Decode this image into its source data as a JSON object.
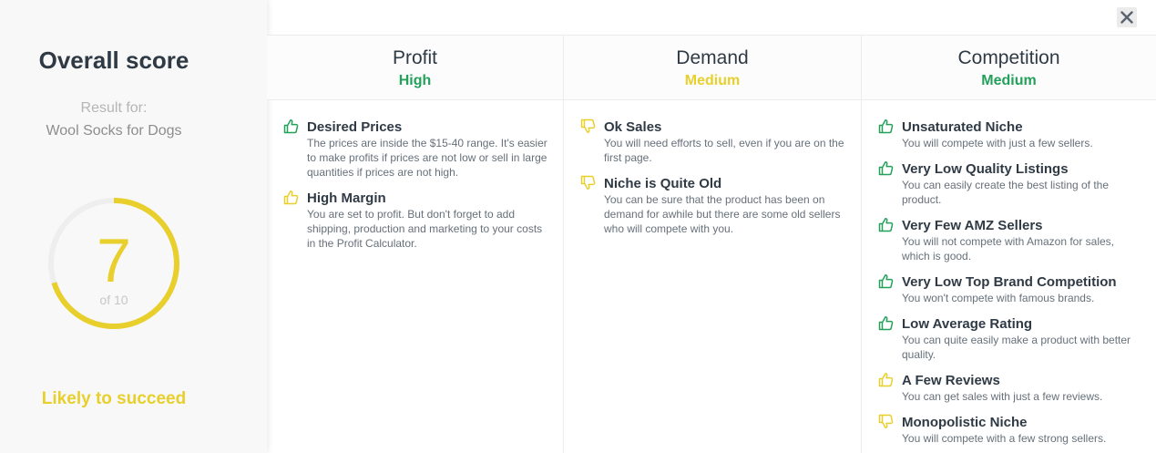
{
  "left": {
    "title": "Overall score",
    "result_label": "Result for:",
    "product": "Wool Socks for Dogs",
    "score": "7",
    "score_suffix": "of 10",
    "score_fraction": 0.7,
    "verdict": "Likely to succeed"
  },
  "close_icon": "close-icon",
  "colors": {
    "green": "#23a15a",
    "yellow": "#e9cf2c",
    "gauge_track": "#eeeeee"
  },
  "columns": [
    {
      "title": "Profit",
      "rating": "High",
      "rating_color": "green",
      "items": [
        {
          "icon": "thumbs-up-icon",
          "color": "green",
          "title": "Desired Prices",
          "desc": "The prices are inside the $15-40 range. It's easier to make profits if prices are not low or sell in large quantities if prices are not high."
        },
        {
          "icon": "thumbs-up-icon",
          "color": "yellow",
          "title": "High Margin",
          "desc": "You are set to profit. But don't forget to add shipping, production and marketing to your costs in the Profit Calculator."
        }
      ]
    },
    {
      "title": "Demand",
      "rating": "Medium",
      "rating_color": "yellow",
      "items": [
        {
          "icon": "thumbs-down-icon",
          "color": "yellow",
          "title": "Ok Sales",
          "desc": "You will need efforts to sell, even if you are on the first page."
        },
        {
          "icon": "thumbs-down-icon",
          "color": "yellow",
          "title": "Niche is Quite Old",
          "desc": "You can be sure that the product has been on demand for awhile but there are some old sellers who will compete with you."
        }
      ]
    },
    {
      "title": "Competition",
      "rating": "Medium",
      "rating_color": "green",
      "items": [
        {
          "icon": "thumbs-up-icon",
          "color": "green",
          "title": "Unsaturated Niche",
          "desc": "You will compete with just a few sellers."
        },
        {
          "icon": "thumbs-up-icon",
          "color": "green",
          "title": "Very Low Quality Listings",
          "desc": "You can easily create the best listing of the product."
        },
        {
          "icon": "thumbs-up-icon",
          "color": "green",
          "title": "Very Few AMZ Sellers",
          "desc": "You will not compete with Amazon for sales, which is good."
        },
        {
          "icon": "thumbs-up-icon",
          "color": "green",
          "title": "Very Low Top Brand Competition",
          "desc": "You won't compete with famous brands."
        },
        {
          "icon": "thumbs-up-icon",
          "color": "green",
          "title": "Low Average Rating",
          "desc": "You can quite easily make a product with better quality."
        },
        {
          "icon": "thumbs-up-icon",
          "color": "yellow",
          "title": "A Few Reviews",
          "desc": "You can get sales with just a few reviews."
        },
        {
          "icon": "thumbs-down-icon",
          "color": "yellow",
          "title": "Monopolistic Niche",
          "desc": "You will compete with a few strong sellers."
        }
      ]
    }
  ]
}
